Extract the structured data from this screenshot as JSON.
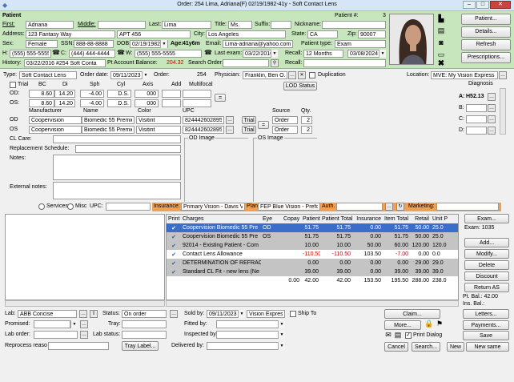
{
  "window": {
    "title": "Order: 254 Lima, Adriana(F) 02/19/1982-41y  - Soft Contact Lens",
    "minimize": "–",
    "maximize": "□",
    "close": "✕"
  },
  "patient": {
    "section_label": "Patient",
    "patient_num_label": "Patient #:",
    "patient_num": "3",
    "first_label": "First:",
    "first": "Adriana",
    "middle_label": "Middle:",
    "middle": "",
    "last_label": "Last:",
    "last": "Lima",
    "title_label": "Title:",
    "title": "Ms.",
    "suffix_label": "Suffix:",
    "suffix": "",
    "nickname_label": "Nickname:",
    "nickname": "",
    "address_label": "Address:",
    "address": "123 Fantasy Way",
    "address2": "APT 456",
    "city_label": "City:",
    "city": "Los Angeles",
    "state_label": "State:",
    "state": "CA",
    "zip_label": "Zip:",
    "zip": "90007",
    "sex_label": "Sex:",
    "sex": "Female",
    "ssn_label": "SSN:",
    "ssn": "888-88-8888",
    "dob_label": "DOB:",
    "dob": "02/19/1982",
    "age_label": "Age:",
    "age": "41y6m",
    "email_label": "Email:",
    "email": "Lima-adriana@yahoo.com",
    "ptype_label": "Patient type:",
    "ptype": "Exam",
    "h_label": "H:",
    "home_phone": "(555) 555-5555",
    "c_label": "C:",
    "cell_phone": "(444) 444-4444",
    "w_label": "W:",
    "work_phone": "(555) 555-5555",
    "last_exam_label": "Last exam:",
    "last_exam": "03/22/2016",
    "recall_label": "Recall:",
    "recall": "12 Months",
    "recall_date": "03/08/2024",
    "history_label": "History:",
    "history": "03/22/2016 #254 Soft Conta",
    "balance_label": "Pt Account Balance:",
    "balance": "204.32",
    "search_order_label": "Search Order:",
    "search_order": "",
    "recall2_label": "Recall:",
    "recall2": ""
  },
  "side_buttons": {
    "patient": "Patient...",
    "details": "Details...",
    "refresh": "Refresh",
    "prescriptions": "Prescriptions..."
  },
  "order": {
    "type_label": "Type:",
    "type": "Soft Contact Lens",
    "order_date_label": "Order date:",
    "order_date": "09/11/2023",
    "order_label": "Order:",
    "order_num": "254",
    "physician_label": "Physician:",
    "physician": "Franklin, Ben O.D. (I",
    "duplication_label": "Duplication",
    "location_label": "Location:",
    "location": "MVE: My Vision Express"
  },
  "rx": {
    "trial_label": "Trial",
    "headers": [
      "BC",
      "Di",
      "Sph",
      "Cyl",
      "Axis",
      "Add",
      "Multifocal"
    ],
    "od_label": "OD:",
    "os_label": "OS:",
    "od": [
      "8.60",
      "14.20",
      "-4.00",
      "D.S.",
      "000",
      ""
    ],
    "os": [
      "8.60",
      "14.20",
      "-4.00",
      "D.S.",
      "000",
      ""
    ],
    "copy_btn": "=",
    "lod_status": "LOD Status"
  },
  "diagnosis": {
    "label": "Diagnosis",
    "a_label": "A:",
    "a_value": "H52.13",
    "b_label": "B:",
    "c_label": "C:",
    "d_label": "D:"
  },
  "lens": {
    "headers": [
      "Manufacturer",
      "Name",
      "Color",
      "UPC",
      "Source",
      "Qty."
    ],
    "od_label": "OD",
    "os_label": "OS",
    "od": {
      "mfr": "Coopervision",
      "name": "Biomedic 55 Premie",
      "color": "Visitint",
      "upc": "824442602895",
      "trial": "Trial",
      "source": "Order",
      "qty": "2"
    },
    "os": {
      "mfr": "Coopervision",
      "name": "Biomedic 55 Premie",
      "color": "Visitint",
      "upc": "824442602895",
      "trial": "Trial",
      "source": "Order",
      "qty": "2"
    }
  },
  "care": {
    "cl_care_label": "CL Care:",
    "replacement_label": "Replacement Schedule:",
    "notes_label": "Notes:",
    "external_notes_label": "External notes:",
    "od_image_label": "OD Image",
    "os_image_label": "OS Image"
  },
  "insurance_bar": {
    "services_label": "Services",
    "misc_label": "Misc",
    "upc_label": "UPC:",
    "insurance_label": "Insurance:",
    "insurance": "Primary Vision - Davis Vis",
    "plan_label": "Plan:",
    "plan": "FEP Blue Vision - Prefix",
    "auth_label": "Auth.",
    "auth": "",
    "marketing_label": "Marketing:",
    "marketing": ""
  },
  "charges": {
    "columns": [
      "Print",
      "Charges",
      "Eye",
      "Copay",
      "Patient",
      "Patient Total",
      "Insurance",
      "Item Total",
      "Retail",
      "Unit P"
    ],
    "rows": [
      {
        "print": "✔",
        "charge": "Coopervision Biomedic 55 Pre",
        "eye": "OD",
        "copay": "",
        "patient": "51.75",
        "ptotal": "51.75",
        "ins": "0.00",
        "itotal": "51.75",
        "retail": "50.00",
        "unit": "25.0",
        "style": "sel"
      },
      {
        "print": "✔",
        "charge": "Coopervision Biomedic 55 Pre",
        "eye": "OS",
        "copay": "",
        "patient": "51.75",
        "ptotal": "51.75",
        "ins": "0.00",
        "itotal": "51.75",
        "retail": "50.00",
        "unit": "25.0",
        "style": "grey"
      },
      {
        "print": "✔",
        "charge": "92014 - Existing Patient - Com",
        "eye": "",
        "copay": "",
        "patient": "10.00",
        "ptotal": "10.00",
        "ins": "50.00",
        "itotal": "60.00",
        "retail": "120.00",
        "unit": "120.0",
        "style": "grey"
      },
      {
        "print": "✔",
        "charge": "Contact Lens Allowance",
        "eye": "",
        "copay": "",
        "patient": "-110.50",
        "ptotal": "-110.50",
        "ins": "103.50",
        "itotal": "-7.00",
        "retail": "0.00",
        "unit": "0.0",
        "style": "white"
      },
      {
        "print": "✔",
        "charge": "DETERMINATION OF REFRACT",
        "eye": "",
        "copay": "",
        "patient": "0.00",
        "ptotal": "0.00",
        "ins": "0.00",
        "itotal": "0.00",
        "retail": "29.00",
        "unit": "29.0",
        "style": "grey"
      },
      {
        "print": "✔",
        "charge": "Standard CL Fit - new lens (Ne",
        "eye": "",
        "copay": "",
        "patient": "39.00",
        "ptotal": "39.00",
        "ins": "0.00",
        "itotal": "39.00",
        "retail": "39.00",
        "unit": "39.0",
        "style": "grey"
      }
    ],
    "totals": {
      "copay": "0.00",
      "patient": "42.00",
      "ptotal": "42.00",
      "ins": "153.50",
      "itotal": "195.50",
      "retail": "288.00",
      "unit": "238.0"
    }
  },
  "right_panel": {
    "exam_btn": "Exam...",
    "exam_label": "Exam: 1035",
    "add_btn": "Add...",
    "modify_btn": "Modify...",
    "delete_btn": "Delete",
    "discount_btn": "Discount",
    "return_as_btn": "Return AS",
    "pt_bal": "Pt. Bal.: 42.00",
    "ins_bal": "Ins. Bal.:"
  },
  "bottom": {
    "lab_label": "Lab:",
    "lab": "ABB Concise",
    "status_label": "Status:",
    "status": "On order",
    "sold_by_label": "Sold by:",
    "sold_by": "09/11/2023",
    "store": "Vision Express",
    "ship_to_label": "Ship To",
    "promised_label": "Promised:",
    "tray_label": "Tray:",
    "fitted_by_label": "Fitted by:",
    "lab_order_label": "Lab order:",
    "lab_status_label": "Lab status:",
    "inspected_by_label": "Inspected by:",
    "reprocess_label": "Reprocess reaso",
    "tray_label_btn": "Tray Label...",
    "delivered_by_label": "Delivered by:",
    "claim_btn": "Claim...",
    "letters_btn": "Letters...",
    "more_btn": "More...",
    "payments_btn": "Payments...",
    "print_dialog_label": "Print Dialog",
    "save_btn": "Save",
    "cancel_btn": "Cancel",
    "search_btn": "Search...",
    "new_btn": "New",
    "new_same_btn": "New same"
  }
}
